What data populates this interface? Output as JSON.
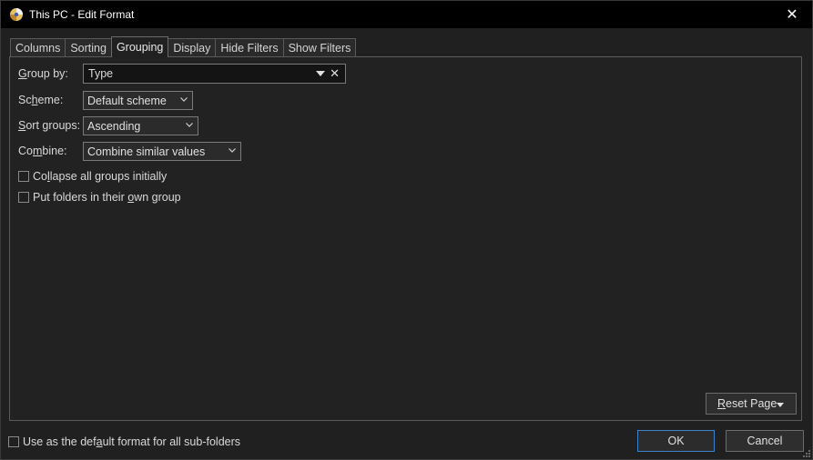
{
  "window": {
    "title": "This PC - Edit Format",
    "close_symbol": "✕"
  },
  "tabs": [
    {
      "label": "Columns",
      "active": false
    },
    {
      "label": "Sorting",
      "active": false
    },
    {
      "label": "Grouping",
      "active": true
    },
    {
      "label": "Display",
      "active": false
    },
    {
      "label": "Hide Filters",
      "active": false
    },
    {
      "label": "Show Filters",
      "active": false
    }
  ],
  "grouping": {
    "group_by": {
      "label_pre": "",
      "label_key": "G",
      "label_post": "roup by:",
      "value": "Type",
      "clear_symbol": "✕"
    },
    "scheme": {
      "label_pre": "Sc",
      "label_key": "h",
      "label_post": "eme:",
      "value": "Default scheme"
    },
    "sort_groups": {
      "label_pre": "",
      "label_key": "S",
      "label_post": "ort groups:",
      "value": "Ascending"
    },
    "combine": {
      "label_pre": "Co",
      "label_key": "m",
      "label_post": "bine:",
      "value": "Combine similar values"
    },
    "collapse": {
      "label_pre": "Co",
      "label_key": "l",
      "label_post": "lapse all groups initially",
      "checked": false
    },
    "folders_own_group": {
      "label_pre": "Put folders in their ",
      "label_key": "o",
      "label_post": "wn group",
      "checked": false
    },
    "reset_page": {
      "label_pre": "",
      "label_key": "R",
      "label_post": "eset Page"
    }
  },
  "footer": {
    "default_format": {
      "label_pre": "Use as the def",
      "label_key": "a",
      "label_post": "ult format for all sub-folders",
      "checked": false
    },
    "ok_label": "OK",
    "cancel_label": "Cancel"
  },
  "colors": {
    "titlebar": "#000000",
    "background": "#202020",
    "accent_border": "#3c84c9"
  },
  "icons": {
    "app": "directory-opus-icon",
    "close": "close-icon",
    "dropdown": "chevron-down-icon"
  }
}
